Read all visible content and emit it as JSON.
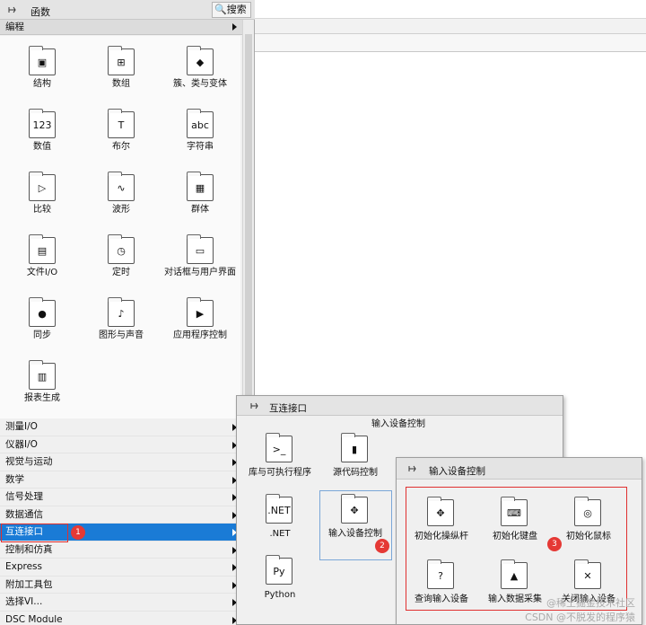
{
  "functions_panel": {
    "title": "函数",
    "search_label": "搜索",
    "category_header": "编程",
    "palette": [
      {
        "label": "结构",
        "icon": "structures-icon"
      },
      {
        "label": "数组",
        "icon": "array-icon"
      },
      {
        "label": "簇、类与变体",
        "icon": "cluster-icon"
      },
      {
        "label": "数值",
        "icon": "numeric-icon"
      },
      {
        "label": "布尔",
        "icon": "boolean-icon"
      },
      {
        "label": "字符串",
        "icon": "string-icon"
      },
      {
        "label": "比较",
        "icon": "comparison-icon"
      },
      {
        "label": "波形",
        "icon": "waveform-icon"
      },
      {
        "label": "群体",
        "icon": "collection-icon"
      },
      {
        "label": "文件I/O",
        "icon": "file-io-icon"
      },
      {
        "label": "定时",
        "icon": "timing-icon"
      },
      {
        "label": "对话框与用户界面",
        "icon": "dialog-icon"
      },
      {
        "label": "同步",
        "icon": "synchronization-icon"
      },
      {
        "label": "图形与声音",
        "icon": "graphics-sound-icon"
      },
      {
        "label": "应用程序控制",
        "icon": "app-control-icon"
      },
      {
        "label": "报表生成",
        "icon": "report-icon"
      }
    ],
    "menu": [
      "测量I/O",
      "仪器I/O",
      "视觉与运动",
      "数学",
      "信号处理",
      "数据通信",
      "互连接口",
      "控制和仿真",
      "Express",
      "附加工具包",
      "选择VI...",
      "DSC Module"
    ],
    "selected_menu": "互连接口"
  },
  "interconnect_panel": {
    "title": "互连接口",
    "subtitle": "输入设备控制",
    "items": [
      {
        "label": "库与可执行程序",
        "icon": "library-icon"
      },
      {
        "label": "源代码控制",
        "icon": "source-control-icon"
      },
      {
        "label": ".NET",
        "icon": "dotnet-icon"
      },
      {
        "label": "输入设备控制",
        "icon": "input-device-icon"
      },
      {
        "label": "Python",
        "icon": "python-icon"
      }
    ]
  },
  "input_device_panel": {
    "title": "输入设备控制",
    "items": [
      {
        "label": "初始化操纵杆",
        "icon": "joystick-init-icon"
      },
      {
        "label": "初始化键盘",
        "icon": "keyboard-init-icon"
      },
      {
        "label": "初始化鼠标",
        "icon": "mouse-init-icon"
      },
      {
        "label": "查询输入设备",
        "icon": "query-device-icon"
      },
      {
        "label": "输入数据采集",
        "icon": "acquire-data-icon"
      },
      {
        "label": "关闭输入设备",
        "icon": "close-device-icon"
      }
    ]
  },
  "badges": [
    "1",
    "2",
    "3"
  ],
  "watermark": {
    "line1": "@稀土掘金技术社区",
    "line2": "CSDN @不脱发的程序猿"
  },
  "colors": {
    "selection": "#1a7bd6",
    "highlight": "#e03030",
    "badge": "#e53935"
  }
}
